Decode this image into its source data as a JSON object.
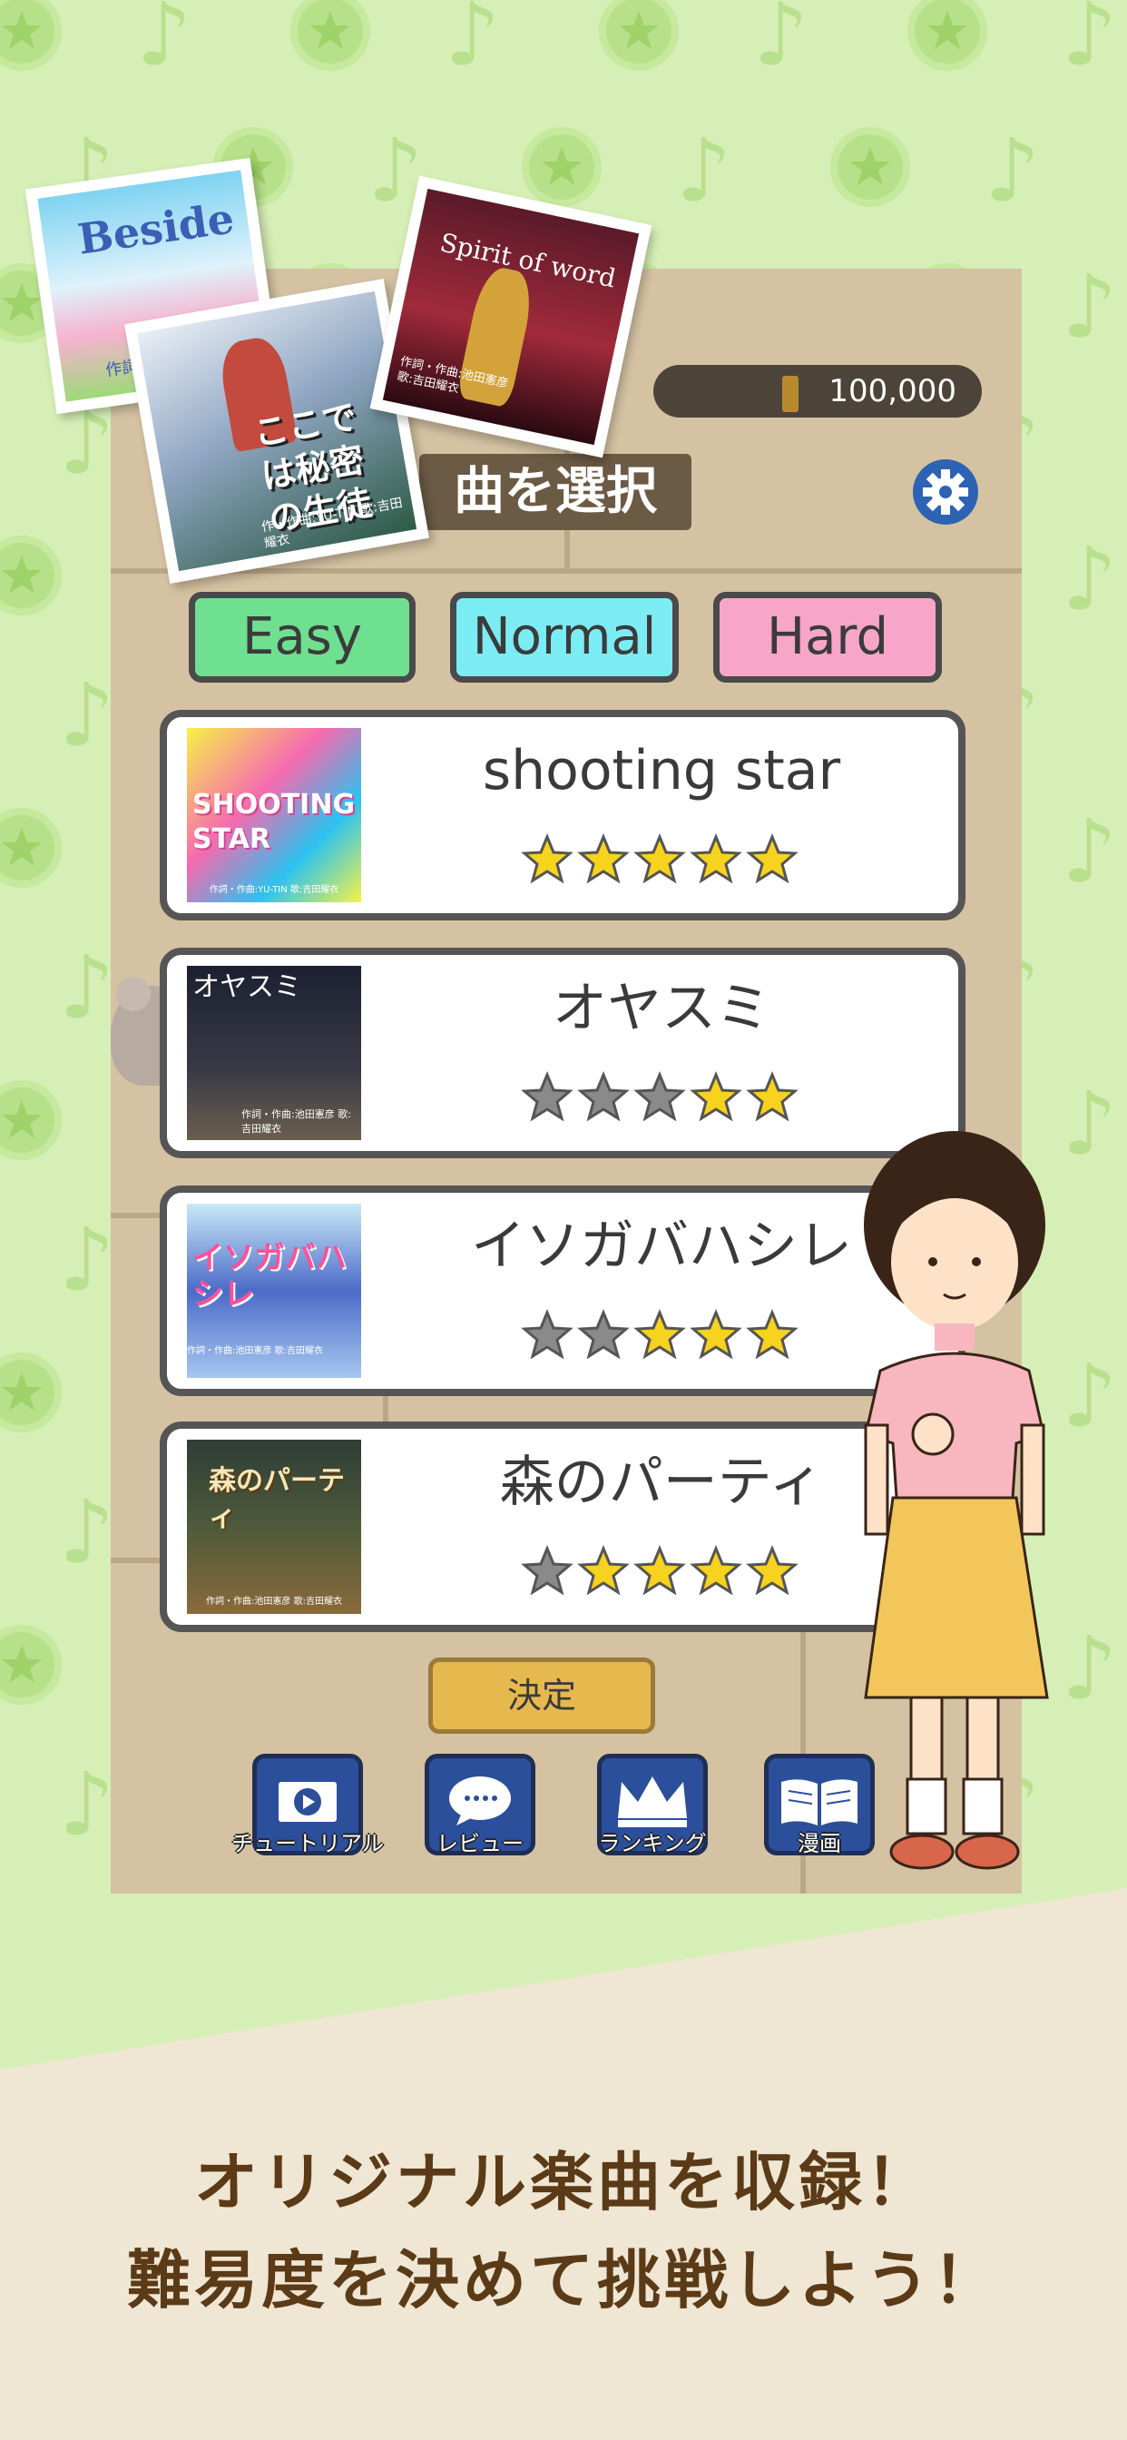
{
  "header": {
    "coins": "100,000",
    "title": "曲を選択"
  },
  "difficulty_tabs": [
    {
      "label": "Easy",
      "color": "#6fe08f"
    },
    {
      "label": "Normal",
      "color": "#7cecf4"
    },
    {
      "label": "Hard",
      "color": "#f7a6c8"
    }
  ],
  "songs": [
    {
      "name": "shooting star",
      "thumb_text": "SHOOTING STAR",
      "rating": 5,
      "credit": "作詞・作曲:YU-TIN 歌:吉田耀衣"
    },
    {
      "name": "オヤスミ",
      "thumb_text": "オヤスミ",
      "rating": 2,
      "credit": "作詞・作曲:池田憲彦 歌:吉田耀衣"
    },
    {
      "name": "イソガバハシレ",
      "thumb_text": "イソガバハシレ",
      "rating": 3,
      "credit": "作詞・作曲:池田憲彦 歌:吉田耀衣"
    },
    {
      "name": "森のパーティ",
      "thumb_text": "森のパーティ",
      "rating": 4,
      "credit": "作詞・作曲:池田憲彦 歌:吉田耀衣"
    }
  ],
  "decide_label": "決定",
  "nav": [
    {
      "label": "チュートリアル",
      "icon": "video-play-icon"
    },
    {
      "label": "レビュー",
      "icon": "speech-bubble-icon"
    },
    {
      "label": "ランキング",
      "icon": "crown-icon"
    },
    {
      "label": "漫画",
      "icon": "open-book-icon"
    }
  ],
  "album_cards": [
    {
      "title": "Beside",
      "credit": "作詞・"
    },
    {
      "title": "ここでは秘密の生徒",
      "credit": "作・作曲:YU-TIN 歌:吉田耀衣"
    },
    {
      "title": "Spirit of word",
      "credit": "作詞・作曲:池田憲彦 歌:吉田耀衣"
    }
  ],
  "caption": {
    "line1": "オリジナル楽曲を収録！",
    "line2": "難易度を決めて挑戦しよう！"
  },
  "colors": {
    "background": "#d6efb6",
    "star_on": "#f7d21e",
    "star_off": "#8a8a8a",
    "caption_text": "#5b3a17"
  }
}
